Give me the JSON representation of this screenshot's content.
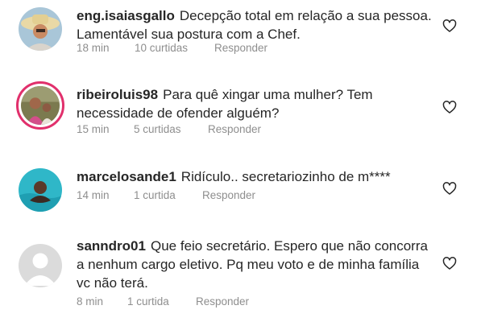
{
  "comments": [
    {
      "username": "eng.isaiasgallo",
      "text": "Decepção total em relação a sua pessoa. Lamentável sua postura com a Chef.",
      "time": "18 min",
      "likes": "10 curtidas",
      "reply_label": "Responder"
    },
    {
      "username": "ribeiroluis98",
      "text": "Para quê xingar uma mulher? Tem necessidade de ofender alguém?",
      "time": "15 min",
      "likes": "5 curtidas",
      "reply_label": "Responder"
    },
    {
      "username": "marcelosande1",
      "text": "Ridículo.. secretariozinho de m****",
      "time": "14 min",
      "likes": "1 curtida",
      "reply_label": "Responder"
    },
    {
      "username": "sanndro01",
      "text": "Que feio secretário. Espero que não concorra a nenhum cargo eletivo. Pq meu voto e de minha família vc não terá.",
      "time": "8 min",
      "likes": "1 curtida",
      "reply_label": "Responder"
    }
  ]
}
